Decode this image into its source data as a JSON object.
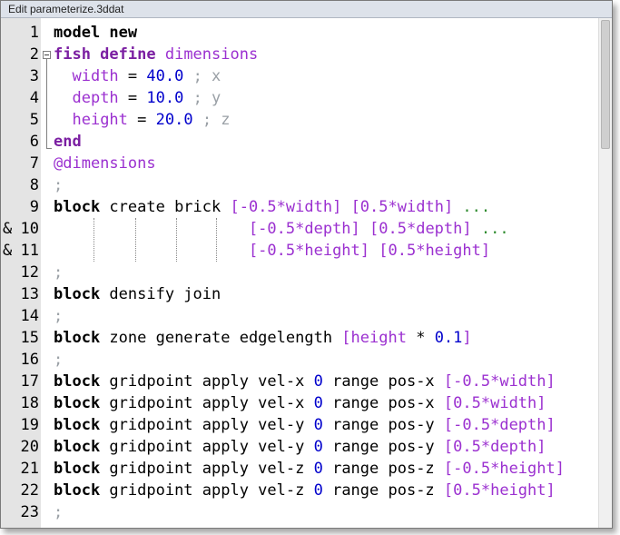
{
  "window": {
    "title": "Edit parameterize.3ddat"
  },
  "lines": [
    {
      "num": "1",
      "cont": "",
      "tokens": [
        {
          "t": "model new",
          "c": "kw"
        }
      ]
    },
    {
      "num": "2",
      "cont": "",
      "tokens": [
        {
          "t": "fish define",
          "c": "kw fish"
        },
        {
          "t": " ",
          "c": "txt"
        },
        {
          "t": "dimensions",
          "c": "var"
        }
      ]
    },
    {
      "num": "3",
      "cont": "",
      "tokens": [
        {
          "t": "  ",
          "c": "txt"
        },
        {
          "t": "width",
          "c": "var"
        },
        {
          "t": " = ",
          "c": "txt"
        },
        {
          "t": "40.0",
          "c": "num"
        },
        {
          "t": " ; x",
          "c": "cmt"
        }
      ]
    },
    {
      "num": "4",
      "cont": "",
      "tokens": [
        {
          "t": "  ",
          "c": "txt"
        },
        {
          "t": "depth",
          "c": "var"
        },
        {
          "t": " = ",
          "c": "txt"
        },
        {
          "t": "10.0",
          "c": "num"
        },
        {
          "t": " ; y",
          "c": "cmt"
        }
      ]
    },
    {
      "num": "5",
      "cont": "",
      "tokens": [
        {
          "t": "  ",
          "c": "txt"
        },
        {
          "t": "height",
          "c": "var"
        },
        {
          "t": " = ",
          "c": "txt"
        },
        {
          "t": "20.0",
          "c": "num"
        },
        {
          "t": " ; z",
          "c": "cmt"
        }
      ]
    },
    {
      "num": "6",
      "cont": "",
      "tokens": [
        {
          "t": "end",
          "c": "kw fish"
        }
      ]
    },
    {
      "num": "7",
      "cont": "",
      "tokens": [
        {
          "t": "@dimensions",
          "c": "var"
        }
      ]
    },
    {
      "num": "8",
      "cont": "",
      "tokens": [
        {
          "t": ";",
          "c": "cmt"
        }
      ]
    },
    {
      "num": "9",
      "cont": "",
      "tokens": [
        {
          "t": "block",
          "c": "kw"
        },
        {
          "t": " create brick ",
          "c": "txt"
        },
        {
          "t": "[-0.5*",
          "c": "brk"
        },
        {
          "t": "width",
          "c": "var"
        },
        {
          "t": "] [0.5*",
          "c": "brk"
        },
        {
          "t": "width",
          "c": "var"
        },
        {
          "t": "]",
          "c": "brk"
        },
        {
          "t": " ...",
          "c": "dots"
        }
      ]
    },
    {
      "num": "10",
      "cont": "&",
      "tokens": [
        {
          "t": "                     ",
          "c": "txt"
        },
        {
          "t": "[-0.5*",
          "c": "brk"
        },
        {
          "t": "depth",
          "c": "var"
        },
        {
          "t": "] [0.5*",
          "c": "brk"
        },
        {
          "t": "depth",
          "c": "var"
        },
        {
          "t": "]",
          "c": "brk"
        },
        {
          "t": " ...",
          "c": "dots"
        }
      ]
    },
    {
      "num": "11",
      "cont": "&",
      "tokens": [
        {
          "t": "                     ",
          "c": "txt"
        },
        {
          "t": "[-0.5*",
          "c": "brk"
        },
        {
          "t": "height",
          "c": "var"
        },
        {
          "t": "] [0.5*",
          "c": "brk"
        },
        {
          "t": "height",
          "c": "var"
        },
        {
          "t": "]",
          "c": "brk"
        }
      ]
    },
    {
      "num": "12",
      "cont": "",
      "tokens": [
        {
          "t": ";",
          "c": "cmt"
        }
      ]
    },
    {
      "num": "13",
      "cont": "",
      "tokens": [
        {
          "t": "block",
          "c": "kw"
        },
        {
          "t": " densify join",
          "c": "txt"
        }
      ]
    },
    {
      "num": "14",
      "cont": "",
      "tokens": [
        {
          "t": ";",
          "c": "cmt"
        }
      ]
    },
    {
      "num": "15",
      "cont": "",
      "tokens": [
        {
          "t": "block",
          "c": "kw"
        },
        {
          "t": " zone generate edgelength ",
          "c": "txt"
        },
        {
          "t": "[",
          "c": "brk"
        },
        {
          "t": "height",
          "c": "var"
        },
        {
          "t": " * ",
          "c": "txt"
        },
        {
          "t": "0.1",
          "c": "num"
        },
        {
          "t": "]",
          "c": "brk"
        }
      ]
    },
    {
      "num": "16",
      "cont": "",
      "tokens": [
        {
          "t": ";",
          "c": "cmt"
        }
      ]
    },
    {
      "num": "17",
      "cont": "",
      "tokens": [
        {
          "t": "block",
          "c": "kw"
        },
        {
          "t": " gridpoint apply vel-x ",
          "c": "txt"
        },
        {
          "t": "0",
          "c": "num"
        },
        {
          "t": " range pos-x ",
          "c": "txt"
        },
        {
          "t": "[-0.5*",
          "c": "brk"
        },
        {
          "t": "width",
          "c": "var"
        },
        {
          "t": "]",
          "c": "brk"
        }
      ]
    },
    {
      "num": "18",
      "cont": "",
      "tokens": [
        {
          "t": "block",
          "c": "kw"
        },
        {
          "t": " gridpoint apply vel-x ",
          "c": "txt"
        },
        {
          "t": "0",
          "c": "num"
        },
        {
          "t": " range pos-x ",
          "c": "txt"
        },
        {
          "t": "[0.5*",
          "c": "brk"
        },
        {
          "t": "width",
          "c": "var"
        },
        {
          "t": "]",
          "c": "brk"
        }
      ]
    },
    {
      "num": "19",
      "cont": "",
      "tokens": [
        {
          "t": "block",
          "c": "kw"
        },
        {
          "t": " gridpoint apply vel-y ",
          "c": "txt"
        },
        {
          "t": "0",
          "c": "num"
        },
        {
          "t": " range pos-y ",
          "c": "txt"
        },
        {
          "t": "[-0.5*",
          "c": "brk"
        },
        {
          "t": "depth",
          "c": "var"
        },
        {
          "t": "]",
          "c": "brk"
        }
      ]
    },
    {
      "num": "20",
      "cont": "",
      "tokens": [
        {
          "t": "block",
          "c": "kw"
        },
        {
          "t": " gridpoint apply vel-y ",
          "c": "txt"
        },
        {
          "t": "0",
          "c": "num"
        },
        {
          "t": " range pos-y ",
          "c": "txt"
        },
        {
          "t": "[0.5*",
          "c": "brk"
        },
        {
          "t": "depth",
          "c": "var"
        },
        {
          "t": "]",
          "c": "brk"
        }
      ]
    },
    {
      "num": "21",
      "cont": "",
      "tokens": [
        {
          "t": "block",
          "c": "kw"
        },
        {
          "t": " gridpoint apply vel-z ",
          "c": "txt"
        },
        {
          "t": "0",
          "c": "num"
        },
        {
          "t": " range pos-z ",
          "c": "txt"
        },
        {
          "t": "[-0.5*",
          "c": "brk"
        },
        {
          "t": "height",
          "c": "var"
        },
        {
          "t": "]",
          "c": "brk"
        }
      ]
    },
    {
      "num": "22",
      "cont": "",
      "tokens": [
        {
          "t": "block",
          "c": "kw"
        },
        {
          "t": " gridpoint apply vel-z ",
          "c": "txt"
        },
        {
          "t": "0",
          "c": "num"
        },
        {
          "t": " range pos-z ",
          "c": "txt"
        },
        {
          "t": "[0.5*",
          "c": "brk"
        },
        {
          "t": "height",
          "c": "var"
        },
        {
          "t": "]",
          "c": "brk"
        }
      ]
    },
    {
      "num": "23",
      "cont": "",
      "tokens": [
        {
          "t": ";",
          "c": "cmt"
        }
      ]
    }
  ]
}
